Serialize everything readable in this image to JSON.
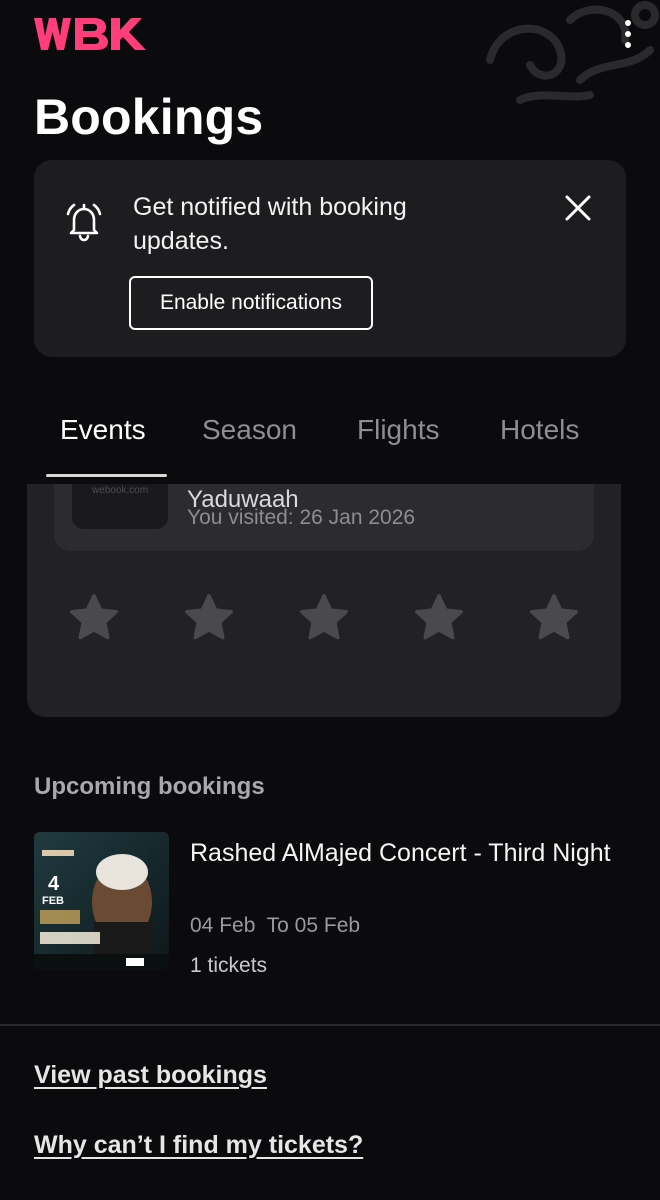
{
  "header": {
    "logo_text": "WBK",
    "page_title": "Bookings",
    "menu_icon": "kebab-menu-icon"
  },
  "notification_banner": {
    "icon": "bell-icon",
    "message": "Get notified with booking updates.",
    "button_label": "Enable notifications",
    "close_icon": "close-icon"
  },
  "tabs": [
    {
      "label": "Events",
      "active": true
    },
    {
      "label": "Season",
      "active": false
    },
    {
      "label": "Flights",
      "active": false
    },
    {
      "label": "Hotels",
      "active": false
    }
  ],
  "review_card": {
    "thumbnail_text": "webook.com",
    "venue_name": "Yaduwaah",
    "visited_text": "You visited: 26 Jan 2026",
    "rating": 0,
    "max_rating": 5
  },
  "upcoming": {
    "section_title": "Upcoming bookings",
    "items": [
      {
        "title": "Rashed AlMajed Concert - Third Night",
        "dates": "04 Feb  To 05 Feb",
        "tickets": "1 tickets",
        "poster_text": "FEB"
      }
    ]
  },
  "links": {
    "past_bookings": "View past bookings",
    "find_tickets": "Why can’t I find my tickets?"
  },
  "colors": {
    "background": "#0b0a0c",
    "card": "#1d1c1f",
    "brand_pink": "#ff3d7a",
    "star_empty": "#4a494e"
  }
}
